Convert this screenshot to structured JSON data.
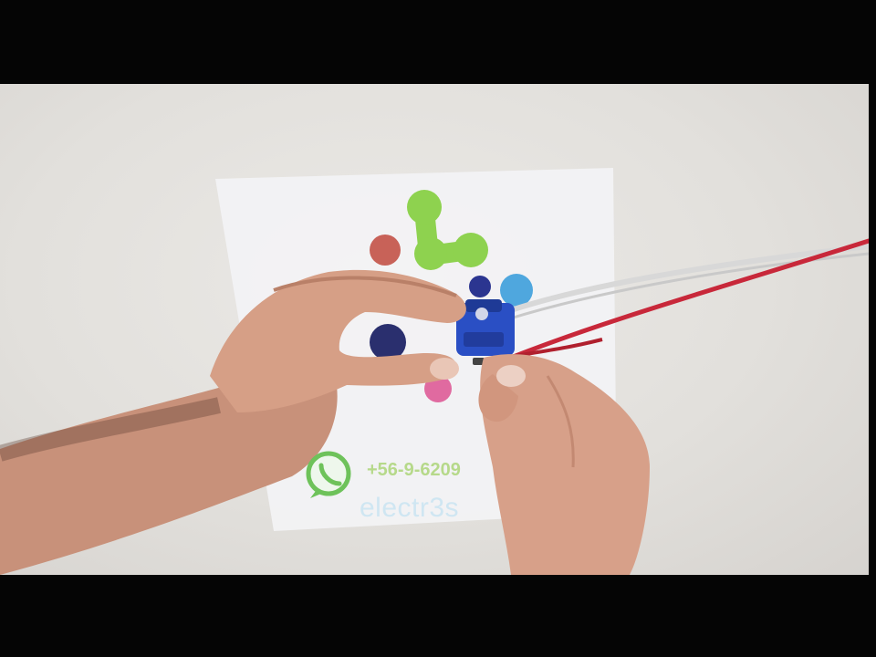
{
  "video_frame": {
    "overlay": {
      "brand_text": "electr3s",
      "phone_text": "+56-9-6209"
    },
    "icons": {
      "messaging": "whatsapp-icon",
      "logo": "molecule-logo-icon"
    },
    "colors": {
      "letterbox": "#050505",
      "table": "#e4e2de",
      "paper": "#f3f3f4",
      "logo_green": "#8ed24f",
      "logo_blue": "#4fa7de",
      "logo_red": "#b5443a",
      "logo_pink": "#e06aa0",
      "logo_navy": "#27307a",
      "wire_red": "#c8283a",
      "wire_white": "#d8d8d8",
      "skin": "#d69f86",
      "servo_blue": "#2a4fc4"
    }
  }
}
